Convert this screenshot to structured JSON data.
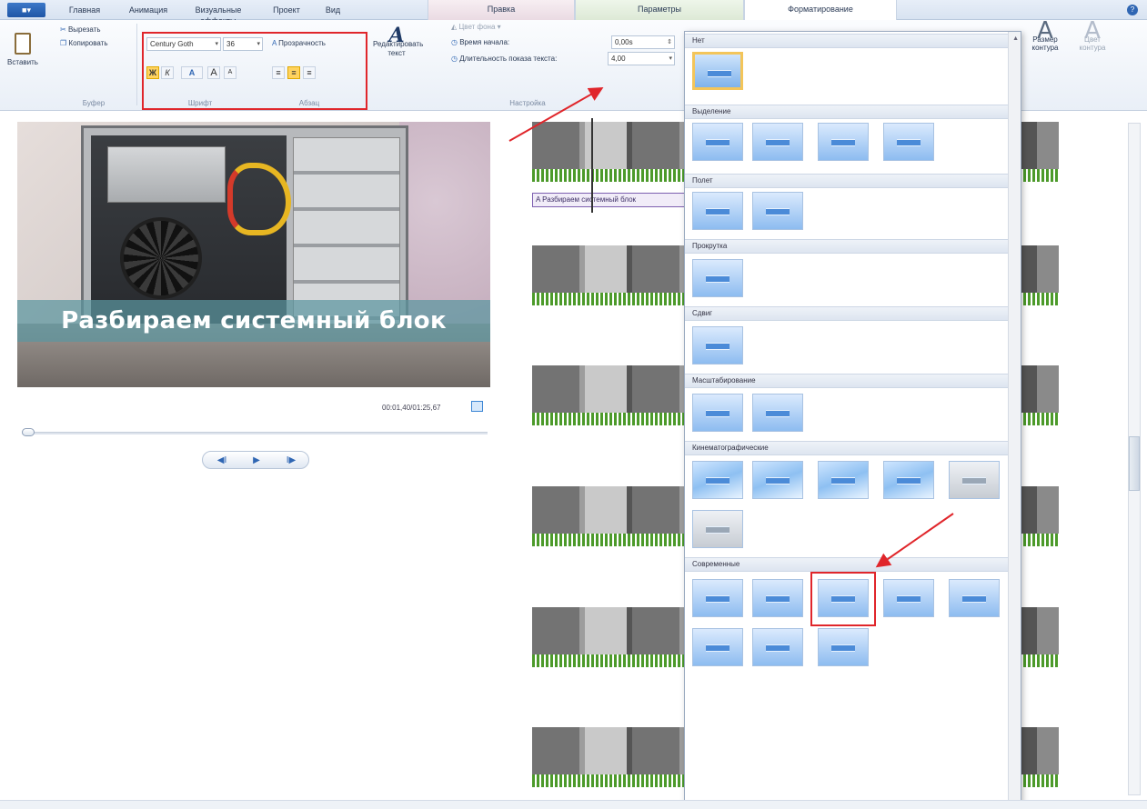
{
  "app_menu": {
    "label": "■▾"
  },
  "tabs": [
    {
      "label": "Главная"
    },
    {
      "label": "Анимация"
    },
    {
      "label": "Визуальные эффекты"
    },
    {
      "label": "Проект"
    },
    {
      "label": "Вид"
    }
  ],
  "context_tabs": [
    {
      "label": "Правка"
    },
    {
      "label": "Параметры"
    },
    {
      "label": "Форматирование"
    }
  ],
  "ribbon": {
    "clipboard": {
      "paste_label": "Вставить",
      "cut_label": "Вырезать",
      "copy_label": "Копировать",
      "group_label": "Буфер"
    },
    "font": {
      "family": "Century Goth",
      "size": "36",
      "transparency_label": "Прозрачность",
      "group_label": "Шрифт",
      "bold": "Ж",
      "italic": "К",
      "color": "A",
      "grow": "A",
      "shrink": "A"
    },
    "paragraph": {
      "group_label": "Абзац"
    },
    "edit_text": {
      "label": "Редактировать текст"
    },
    "settings": {
      "bg_color_label": "Цвет фона",
      "start_time_label": "Время начала:",
      "start_time_value": "0,00s",
      "duration_label": "Длительность показа текста:",
      "duration_value": "4,00",
      "group_label": "Настройка"
    },
    "outline_size_label": "Размер контура",
    "outline_color_label": "Цвет контура"
  },
  "preview": {
    "caption": "Разбираем системный блок",
    "time": "00:01,40/01:25,67",
    "controls": {
      "prev": "◀I",
      "play": "▶",
      "next": "I▶"
    }
  },
  "storyboard": {
    "caption_clip_text": "A Разбираем системный блок"
  },
  "effects_gallery": {
    "sections": [
      {
        "title": "Нет",
        "count": 1
      },
      {
        "title": "Выделение",
        "count": 4
      },
      {
        "title": "Полет",
        "count": 2
      },
      {
        "title": "Прокрутка",
        "count": 1
      },
      {
        "title": "Сдвиг",
        "count": 1
      },
      {
        "title": "Масштабирование",
        "count": 2
      },
      {
        "title": "Кинематографические",
        "count": 6
      },
      {
        "title": "Современные",
        "count": 8
      }
    ],
    "selected_section": "Нет",
    "highlighted_section": "Современные",
    "highlighted_index": 3
  },
  "colors": {
    "highlight_red": "#e0262b",
    "selected_border": "#f3c55a",
    "accent_blue": "#4b8bd8",
    "audio_green": "#4c9a2a"
  }
}
